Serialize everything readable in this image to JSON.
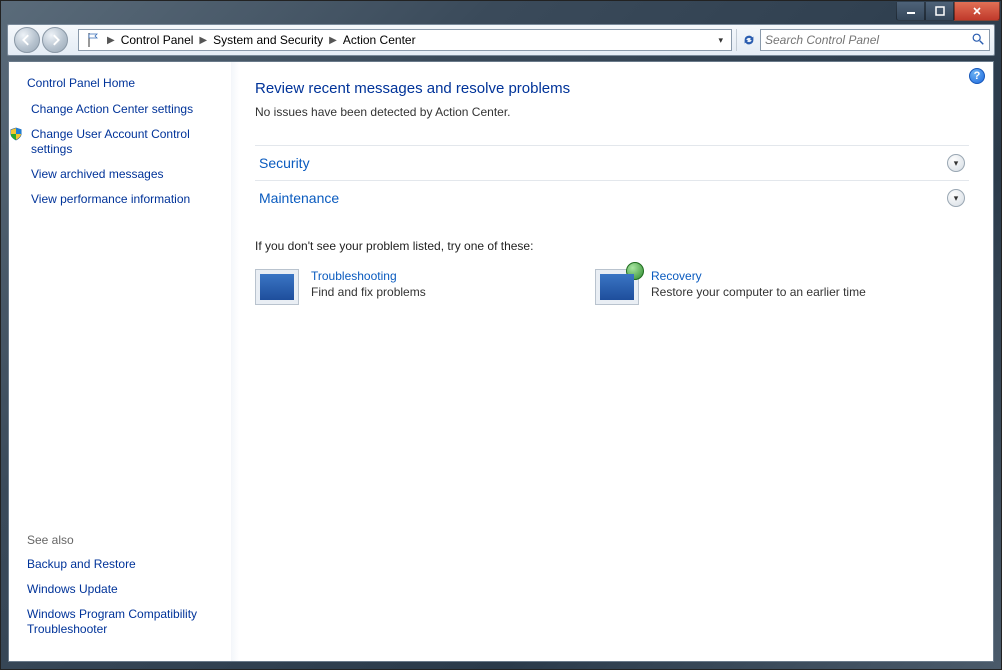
{
  "window": {
    "min_tooltip": "Minimize",
    "max_tooltip": "Maximize",
    "close_tooltip": "Close"
  },
  "address": {
    "crumbs": [
      "Control Panel",
      "System and Security",
      "Action Center"
    ]
  },
  "search": {
    "placeholder": "Search Control Panel"
  },
  "sidebar": {
    "home": "Control Panel Home",
    "links": [
      "Change Action Center settings",
      "Change User Account Control settings",
      "View archived messages",
      "View performance information"
    ],
    "see_also_heading": "See also",
    "see_also": [
      "Backup and Restore",
      "Windows Update",
      "Windows Program Compatibility Troubleshooter"
    ]
  },
  "main": {
    "heading": "Review recent messages and resolve problems",
    "status": "No issues have been detected by Action Center.",
    "sections": {
      "security": "Security",
      "maintenance": "Maintenance"
    },
    "tryone": "If you don't see your problem listed, try one of these:",
    "tiles": {
      "troubleshooting": {
        "title": "Troubleshooting",
        "desc": "Find and fix problems"
      },
      "recovery": {
        "title": "Recovery",
        "desc": "Restore your computer to an earlier time"
      }
    }
  }
}
